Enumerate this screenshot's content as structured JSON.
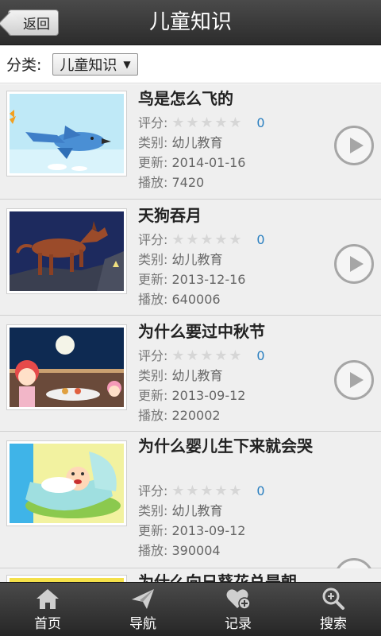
{
  "header": {
    "back_label": "返回",
    "title": "儿童知识"
  },
  "filter": {
    "label": "分类:",
    "selected": "儿童知识",
    "caret": "▼"
  },
  "meta_keys": {
    "rating": "评分:",
    "category": "类别:",
    "updated": "更新:",
    "plays": "播放:"
  },
  "items": [
    {
      "title": "鸟是怎么飞的",
      "rating": "0",
      "category": "幼儿教育",
      "updated": "2014-01-16",
      "plays": "7420",
      "stars": 0
    },
    {
      "title": "天狗吞月",
      "rating": "0",
      "category": "幼儿教育",
      "updated": "2013-12-16",
      "plays": "640006",
      "stars": 0
    },
    {
      "title": "为什么要过中秋节",
      "rating": "0",
      "category": "幼儿教育",
      "updated": "2013-09-12",
      "plays": "220002",
      "stars": 0
    },
    {
      "title": "为什么婴儿生下来就会哭",
      "rating": "0",
      "category": "幼儿教育",
      "updated": "2013-09-12",
      "plays": "390004",
      "stars": 0
    },
    {
      "title": "为什么向日葵花总是朝"
    }
  ],
  "nav": [
    {
      "label": "首页",
      "icon": "home-icon"
    },
    {
      "label": "导航",
      "icon": "send-icon"
    },
    {
      "label": "记录",
      "icon": "heart-plus-icon"
    },
    {
      "label": "搜索",
      "icon": "search-icon"
    }
  ],
  "colors": {
    "header": "#2c2c2c",
    "rating_value": "#2a7fc0",
    "list_bg": "#efefef"
  }
}
